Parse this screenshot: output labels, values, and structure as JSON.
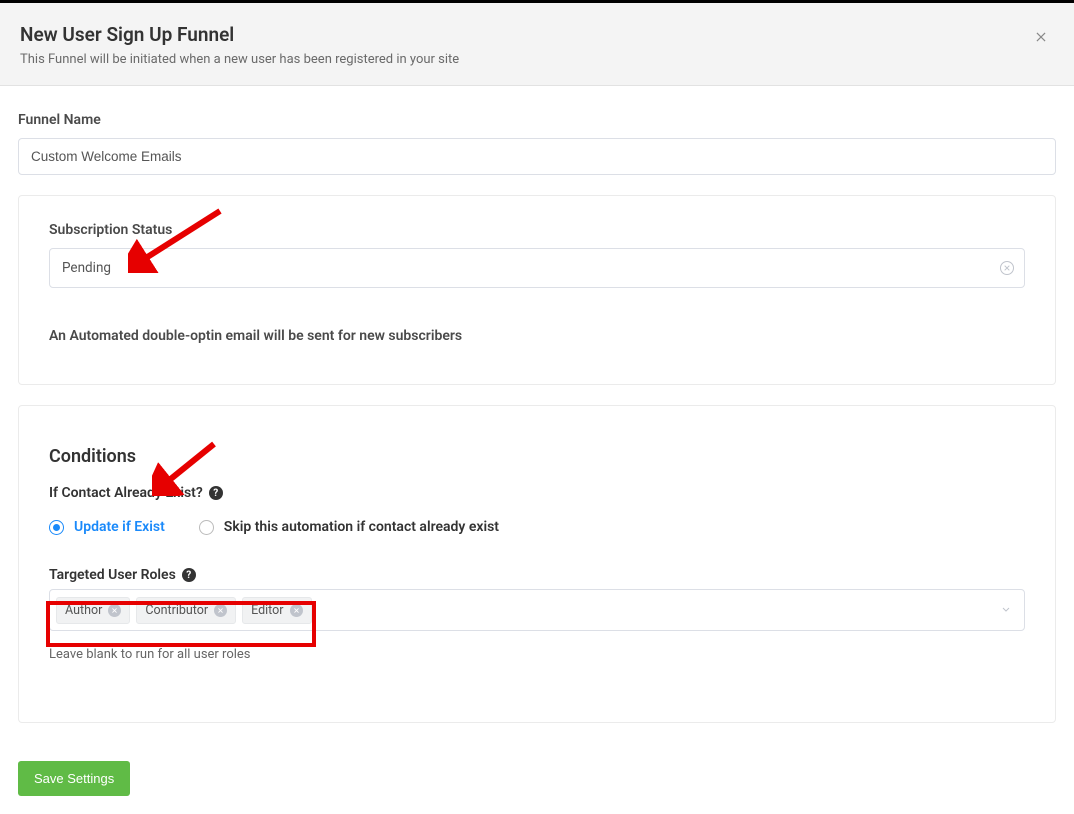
{
  "header": {
    "title": "New User Sign Up Funnel",
    "subtitle": "This Funnel will be initiated when a new user has been registered in your site"
  },
  "funnel_name": {
    "label": "Funnel Name",
    "value": "Custom Welcome Emails"
  },
  "subscription": {
    "label": "Subscription Status",
    "value": "Pending",
    "hint": "An Automated double-optin email will be sent for new subscribers"
  },
  "conditions": {
    "title": "Conditions",
    "contact_exist_label": "If Contact Already Exist?",
    "radios": {
      "update": "Update if Exist",
      "skip": "Skip this automation if contact already exist"
    },
    "selected_radio": "update",
    "roles_label": "Targeted User Roles",
    "roles": [
      "Author",
      "Contributor",
      "Editor"
    ],
    "roles_help": "Leave blank to run for all user roles"
  },
  "footer": {
    "save_label": "Save Settings"
  }
}
